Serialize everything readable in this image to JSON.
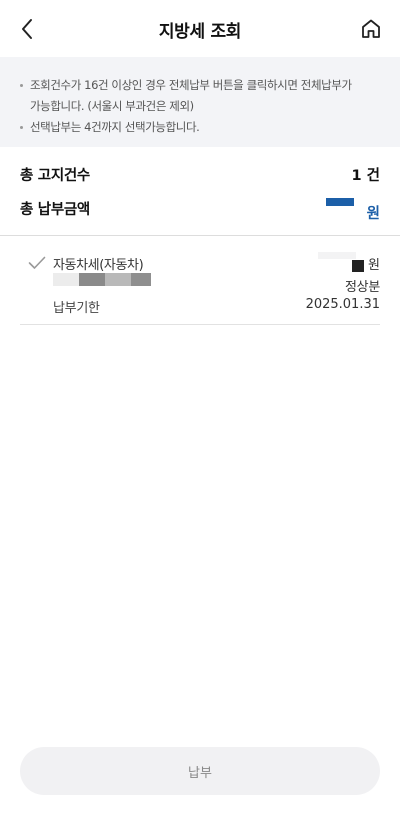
{
  "header": {
    "title": "지방세 조회",
    "back_icon": "chevron-left-icon",
    "home_icon": "home-icon"
  },
  "notice": {
    "line1": "조회건수가 16건 이상인 경우 전체납부 버튼을 클릭하시면 전체납부가",
    "line1b": "가능합니다. (서울시 부과건은 제외)",
    "line2": "선택납부는 4건까지 선택가능합니다."
  },
  "summary": {
    "count_label": "총 고지건수",
    "count_value": "1 건",
    "amount_label": "총 납부금액",
    "amount_unit": "원"
  },
  "items": [
    {
      "name": "자동차세(자동차)",
      "amount_unit": "원",
      "status": "정상분",
      "due_label": "납부기한",
      "due_date": "2025.01.31"
    }
  ],
  "pay_button": {
    "label": "납부"
  },
  "colors": {
    "accent": "#1c5fa8",
    "notice_bg": "#f3f4f7",
    "button_bg": "#f1f1f3"
  }
}
